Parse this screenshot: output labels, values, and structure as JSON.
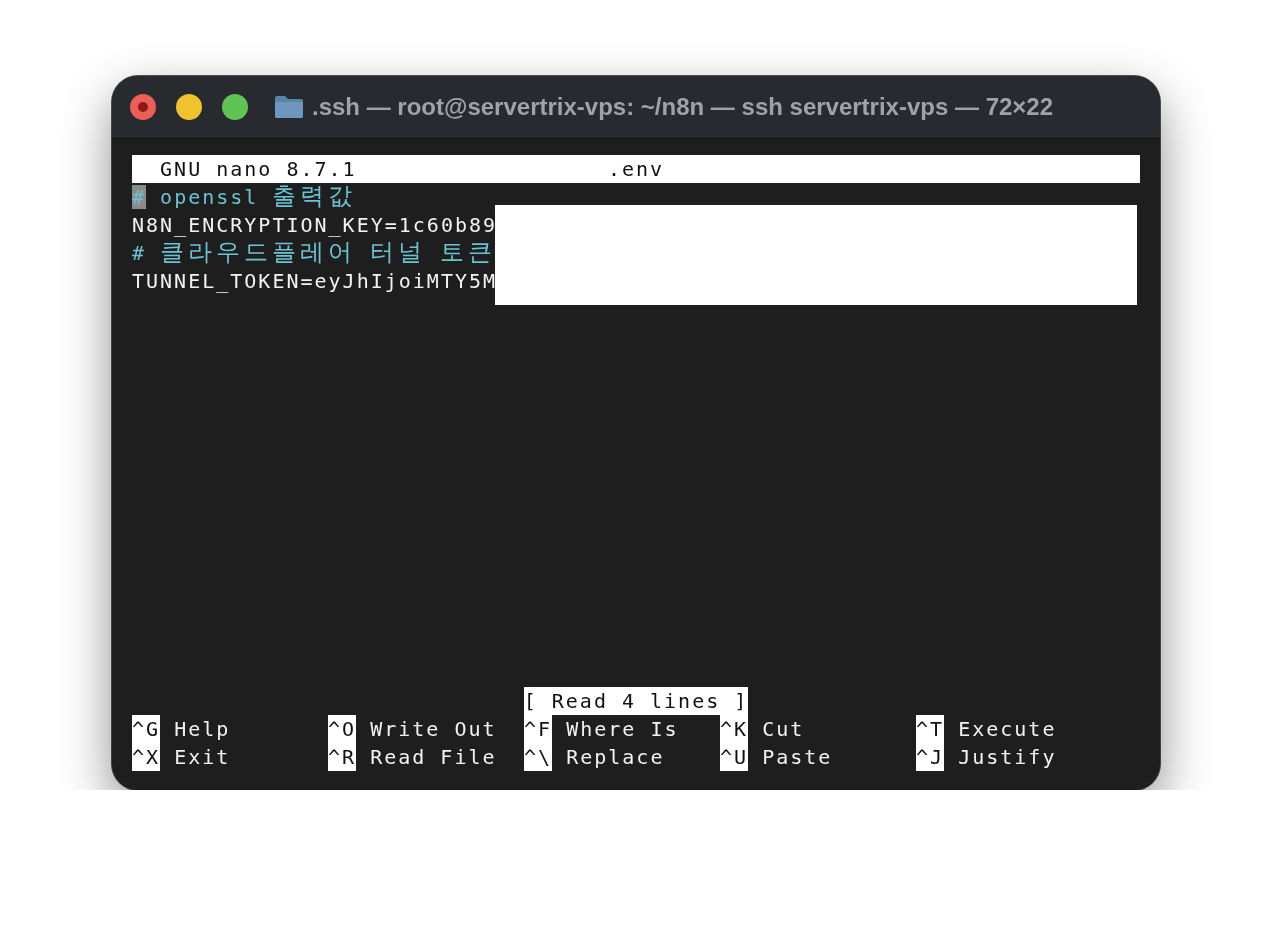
{
  "window": {
    "title": ".ssh — root@servertrix-vps: ~/n8n — ssh servertrix-vps — 72×22"
  },
  "editor": {
    "app": "GNU nano 8.7.1",
    "filename": ".env",
    "redacted": true,
    "lines": [
      {
        "kind": "comment",
        "text": "# openssl 출력값",
        "cursor_at_start": true
      },
      {
        "kind": "text",
        "text": "N8N_ENCRYPTION_KEY=1c60b89",
        "cursor_at_start": false
      },
      {
        "kind": "comment",
        "text": "# 클라우드플레어 터널 토큰",
        "cursor_at_start": false
      },
      {
        "kind": "text",
        "text": "TUNNEL_TOKEN=eyJhIjoiMTY5M",
        "cursor_at_start": false
      }
    ],
    "status": "[ Read 4 lines ]",
    "shortcuts": [
      {
        "key": "^G",
        "label": "Help"
      },
      {
        "key": "^O",
        "label": "Write Out"
      },
      {
        "key": "^F",
        "label": "Where Is"
      },
      {
        "key": "^K",
        "label": "Cut"
      },
      {
        "key": "^T",
        "label": "Execute"
      },
      {
        "key": "^X",
        "label": "Exit"
      },
      {
        "key": "^R",
        "label": "Read File"
      },
      {
        "key": "^\\",
        "label": "Replace"
      },
      {
        "key": "^U",
        "label": "Paste"
      },
      {
        "key": "^J",
        "label": "Justify"
      }
    ]
  }
}
